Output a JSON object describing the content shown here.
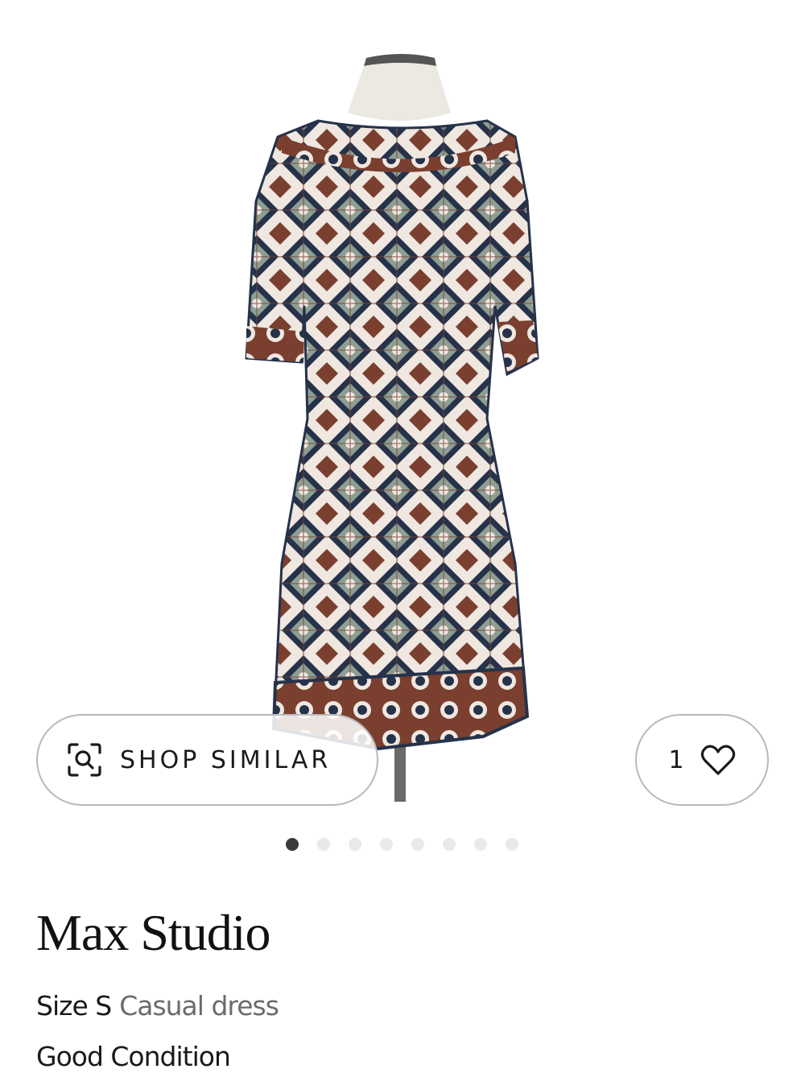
{
  "product": {
    "brand": "Max Studio",
    "size": "Size S",
    "category": "Casual dress",
    "condition": "Good Condition"
  },
  "actions": {
    "shop_similar_label": "SHOP SIMILAR",
    "shop_similar_icon": "visual-search-icon",
    "favorite_count": "1",
    "favorite_icon": "heart-icon"
  },
  "gallery": {
    "image_count": 8,
    "active_index": 0
  },
  "colors": {
    "dress_navy": "#25324a",
    "dress_rust": "#7a3f2f",
    "dress_sage": "#8e9e93",
    "pill_border": "#b9b9b9",
    "dot_active": "#3a3a3a",
    "dot_inactive": "#e9e9e9"
  }
}
